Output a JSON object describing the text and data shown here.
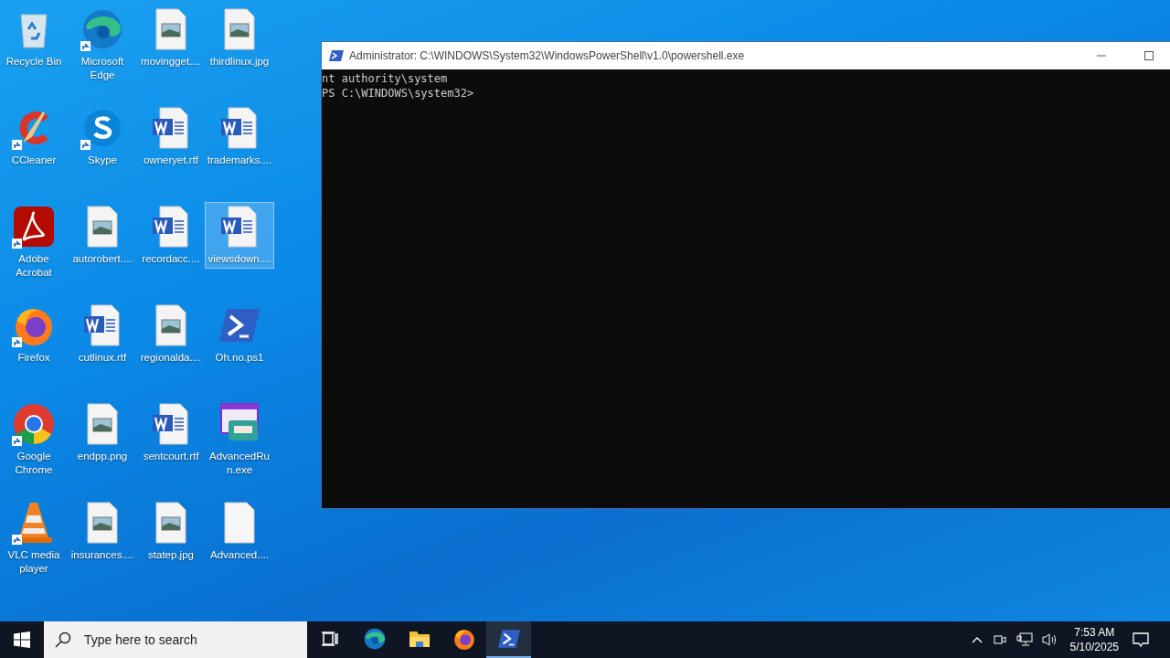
{
  "desktop": {
    "icons": [
      {
        "label": "Recycle Bin",
        "kind": "recycle",
        "shortcut": false,
        "selected": false
      },
      {
        "label": "CCleaner",
        "kind": "ccleaner",
        "shortcut": true,
        "selected": false
      },
      {
        "label": "Adobe Acrobat",
        "kind": "acrobat",
        "shortcut": true,
        "selected": false
      },
      {
        "label": "Firefox",
        "kind": "firefox",
        "shortcut": true,
        "selected": false
      },
      {
        "label": "Google Chrome",
        "kind": "chrome",
        "shortcut": true,
        "selected": false
      },
      {
        "label": "VLC media player",
        "kind": "vlc",
        "shortcut": true,
        "selected": false
      },
      {
        "label": "Microsoft Edge",
        "kind": "edge",
        "shortcut": true,
        "selected": false
      },
      {
        "label": "Skype",
        "kind": "skype",
        "shortcut": true,
        "selected": false
      },
      {
        "label": "autorobert....",
        "kind": "image",
        "shortcut": false,
        "selected": false
      },
      {
        "label": "cutlinux.rtf",
        "kind": "word",
        "shortcut": false,
        "selected": false
      },
      {
        "label": "endpp.png",
        "kind": "image",
        "shortcut": false,
        "selected": false
      },
      {
        "label": "insurances....",
        "kind": "image",
        "shortcut": false,
        "selected": false
      },
      {
        "label": "movingget....",
        "kind": "image",
        "shortcut": false,
        "selected": false
      },
      {
        "label": "owneryet.rtf",
        "kind": "word",
        "shortcut": false,
        "selected": false
      },
      {
        "label": "recordacc....",
        "kind": "word",
        "shortcut": false,
        "selected": false
      },
      {
        "label": "regionalda....",
        "kind": "image",
        "shortcut": false,
        "selected": false
      },
      {
        "label": "sentcourt.rtf",
        "kind": "word",
        "shortcut": false,
        "selected": false
      },
      {
        "label": "statep.jpg",
        "kind": "image",
        "shortcut": false,
        "selected": false
      },
      {
        "label": "thirdlinux.jpg",
        "kind": "image",
        "shortcut": false,
        "selected": false
      },
      {
        "label": "trademarks....",
        "kind": "word",
        "shortcut": false,
        "selected": false
      },
      {
        "label": "viewsdown....",
        "kind": "word",
        "shortcut": false,
        "selected": true
      },
      {
        "label": "Oh.no.ps1",
        "kind": "powershell",
        "shortcut": false,
        "selected": false
      },
      {
        "label": "AdvancedRun.exe",
        "kind": "advancedrun",
        "shortcut": false,
        "selected": false
      },
      {
        "label": "Advanced....",
        "kind": "blank",
        "shortcut": false,
        "selected": false
      }
    ]
  },
  "window": {
    "title": "Administrator: C:\\WINDOWS\\System32\\WindowsPowerShell\\v1.0\\powershell.exe",
    "lines": [
      "nt authority\\system",
      "PS C:\\WINDOWS\\system32>"
    ]
  },
  "taskbar": {
    "search": {
      "placeholder": "Type here to search"
    },
    "apps": [
      {
        "kind": "taskview",
        "active": false
      },
      {
        "kind": "edge",
        "active": false
      },
      {
        "kind": "explorer",
        "active": false
      },
      {
        "kind": "firefox",
        "active": false
      },
      {
        "kind": "powershell",
        "active": true
      }
    ],
    "clock": {
      "time": "7:53 AM",
      "date": "5/10/2025"
    }
  }
}
